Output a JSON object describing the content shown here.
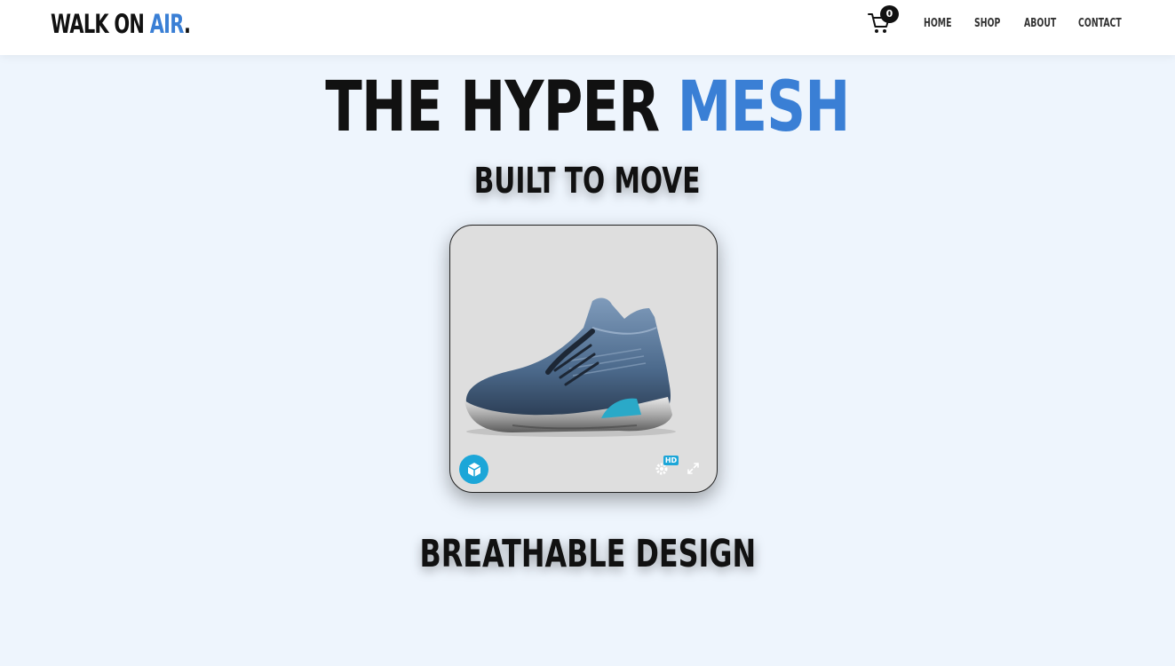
{
  "header": {
    "logo": {
      "part1": "WALK ON ",
      "accent": "AIR",
      "dot": "."
    },
    "cart_count": "0",
    "nav": [
      "HOME",
      "SHOP",
      "ABOUT",
      "CONTACT"
    ]
  },
  "hero": {
    "title_main": "THE HYPER ",
    "title_accent": "MESH",
    "subtitle": "BUILT TO MOVE"
  },
  "viewer": {
    "hd_label": "HD",
    "icons": [
      "viewer-logo-icon",
      "settings-gear-icon",
      "fullscreen-icon"
    ]
  },
  "section": {
    "title": "BREATHABLE DESIGN"
  },
  "colors": {
    "accent": "#3a7fd5",
    "background": "#eef5fd",
    "viewer_bg": "#dedede",
    "viewer_brand": "#1ca6d8"
  }
}
